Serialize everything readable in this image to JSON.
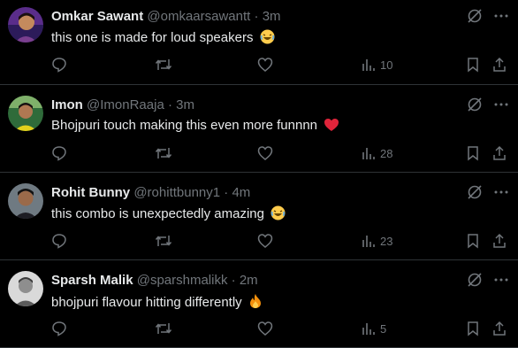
{
  "tweets": [
    {
      "name": "Omkar Sawant",
      "handle": "@omkaarsawantt",
      "sep": "·",
      "time": "3m",
      "text": "this one is made for loud speakers",
      "emoji": "laughing-emoji",
      "views": "10"
    },
    {
      "name": "Imon",
      "handle": "@ImonRaaja",
      "sep": "·",
      "time": "3m",
      "text": "Bhojpuri touch making this even more funnnn",
      "emoji": "heart-emoji",
      "views": "28"
    },
    {
      "name": "Rohit Bunny",
      "handle": "@rohittbunny1",
      "sep": "·",
      "time": "4m",
      "text": "this combo is unexpectedly amazing",
      "emoji": "laughing-emoji",
      "views": "23"
    },
    {
      "name": "Sparsh Malik",
      "handle": "@sparshmalikk",
      "sep": "·",
      "time": "2m",
      "text": "bhojpuri flavour hitting differently",
      "emoji": "fire-emoji",
      "views": "5"
    }
  ],
  "colors": {
    "background": "#000000",
    "text": "#e7e9ea",
    "muted": "#71767b",
    "divider": "#2f3336",
    "heart": "#f91880"
  }
}
